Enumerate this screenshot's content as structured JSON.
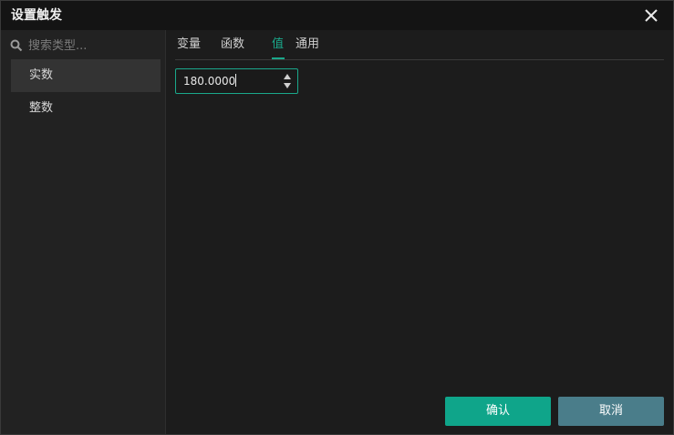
{
  "window": {
    "title": "设置触发"
  },
  "sidebar": {
    "search": {
      "placeholder": "搜索类型..."
    },
    "items": [
      {
        "label": "实数",
        "active": true
      },
      {
        "label": "整数",
        "active": false
      }
    ]
  },
  "tabs": [
    {
      "label": "变量"
    },
    {
      "label": "函数"
    },
    {
      "label": "值",
      "active": true
    },
    {
      "label": "通用"
    }
  ],
  "value_input": {
    "value": "180.0000"
  },
  "footer": {
    "confirm_label": "确认",
    "cancel_label": "取消"
  },
  "colors": {
    "accent": "#1aa88b",
    "confirm": "#0fa58a",
    "cancel": "#4a7d8a"
  }
}
